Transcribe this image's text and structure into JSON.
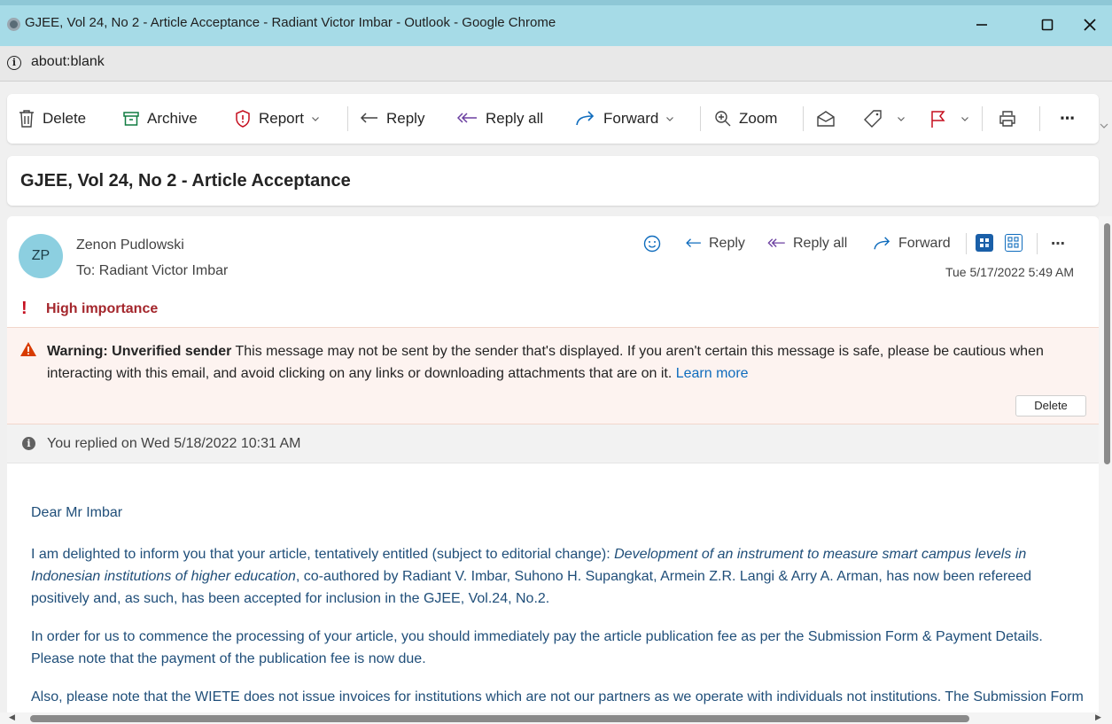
{
  "window": {
    "title": "GJEE, Vol 24, No 2 - Article Acceptance - Radiant Victor Imbar - Outlook - Google Chrome",
    "url": "about:blank"
  },
  "toolbar": {
    "delete": "Delete",
    "archive": "Archive",
    "report": "Report",
    "reply": "Reply",
    "reply_all": "Reply all",
    "forward": "Forward",
    "zoom": "Zoom",
    "more": "⋯"
  },
  "subject": "GJEE, Vol 24, No 2 - Article Acceptance",
  "message": {
    "avatar_initials": "ZP",
    "sender": "Zenon Pudlowski",
    "to_label": "To:",
    "recipient": "Radiant Victor Imbar",
    "actions": {
      "reply": "Reply",
      "reply_all": "Reply all",
      "forward": "Forward",
      "more": "⋯"
    },
    "timestamp": "Tue 5/17/2022 5:49 AM",
    "importance": "High importance",
    "warning": {
      "title": "Warning: Unverified sender",
      "text": " This message may not be sent by the sender that's displayed. If you aren't certain this message is safe, please be cautious when interacting with this email, and avoid clicking on any links or downloading attachments that are on it. ",
      "link": "Learn more",
      "delete_button": "Delete"
    },
    "replied_notice": "You replied on Wed 5/18/2022 10:31 AM",
    "body": {
      "greeting": "Dear Mr Imbar",
      "p1_before": "I am delighted to inform you that your article, tentatively entitled (subject to editorial change): ",
      "p1_title": "Development of an instrument to measure smart campus levels in Indonesian institutions of higher education",
      "p1_after": ", co-authored by Radiant V. Imbar, Suhono H. Supangkat, Armein Z.R. Langi & Arry A. Arman, has now been refereed positively and, as such, has been accepted for inclusion in the GJEE, Vol.24, No.2.",
      "p2": "In order for us to commence the processing of your article, you should immediately pay the article publication fee as per the Submission Form & Payment Details. Please note that the payment of the publication fee is now due.",
      "p3": "Also, please note that the WIETE does not issue invoices for institutions which are not our partners as we operate with individuals not institutions. The Submission Form & Payment Details is the pro forma invoice, and is issued with individual authors."
    }
  },
  "colors": {
    "titlebar": "#a6dbe7",
    "report_red": "#c50f1f",
    "forward_blue": "#0f6cbd",
    "body_text": "#1f4e79",
    "importance": "#a4262c"
  }
}
